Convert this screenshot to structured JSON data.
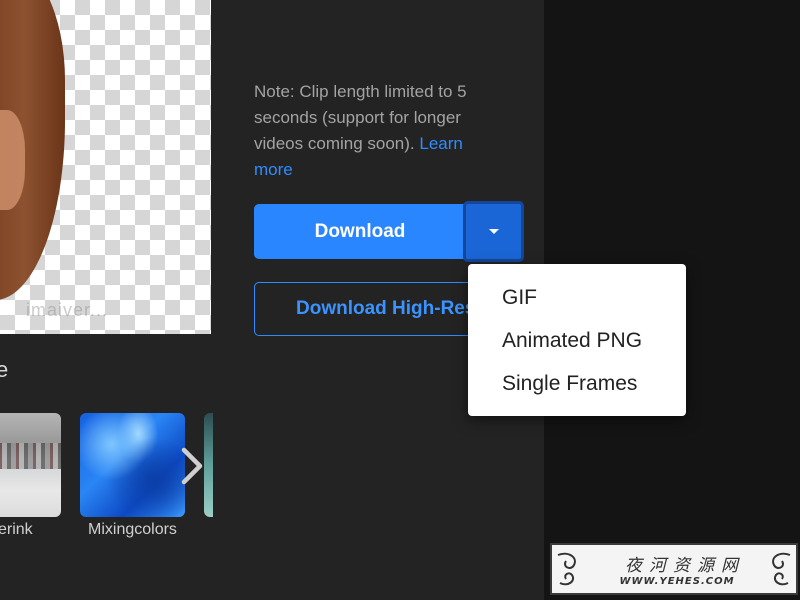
{
  "note": {
    "text": "Note: Clip length limited to 5 seconds (support for longer videos coming soon). ",
    "link": "Learn more"
  },
  "buttons": {
    "download": "Download",
    "download_hires": "Download High-Res"
  },
  "dropdown": {
    "items": [
      "GIF",
      "Animated PNG",
      "Single Frames"
    ]
  },
  "section": {
    "title": "e"
  },
  "thumbnails": [
    {
      "label": "erink"
    },
    {
      "label": "Mixingcolors"
    }
  ],
  "preview": {
    "watermark_text": "imaiver..."
  },
  "watermark": {
    "title": "夜河资源网",
    "url": "WWW.YEHES.COM"
  },
  "colors": {
    "accent": "#2a86ff",
    "accent_dark": "#1b66d6",
    "panel": "#232323",
    "background": "#141414"
  }
}
